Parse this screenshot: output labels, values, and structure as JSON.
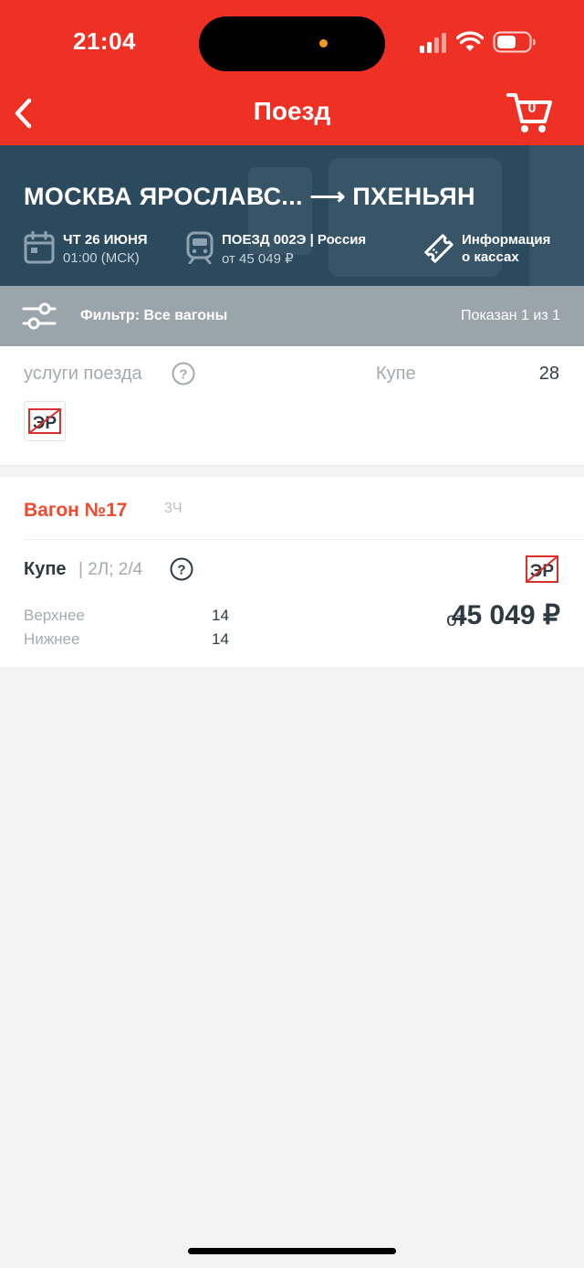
{
  "status_bar": {
    "time": "21:04"
  },
  "app_bar": {
    "title": "Поезд",
    "cart_count": "0",
    "back_icon": "chevron-left-icon",
    "cart_icon": "cart-icon"
  },
  "route": {
    "title": "МОСКВА ЯРОСЛАВС... ⟶ ПХЕНЬЯН",
    "date": "ЧТ 26 ИЮНЯ",
    "time": "01:00 (МСК)",
    "train": "ПОЕЗД 002Э | Россия",
    "price_from": "от 45 049 ₽",
    "info_line1": "Информация",
    "info_line2": "о кассах"
  },
  "filter": {
    "label": "Фильтр: Все вагоны",
    "shown": "Показан 1 из 1"
  },
  "services": {
    "label": "услуги поезда",
    "class_label": "Купе",
    "class_count": "28",
    "er_text": "ЭР"
  },
  "wagon": {
    "number": "Вагон №17",
    "code": "3Ч",
    "type": "Купе",
    "detail": "| 2Л; 2/4",
    "upper_label": "Верхнее",
    "upper_count": "14",
    "lower_label": "Нижнее",
    "lower_count": "14",
    "price_prefix": "от",
    "price": "45 049 ₽",
    "er_text": "ЭР"
  },
  "colors": {
    "brand_red": "#ee3124",
    "banner": "#2c4a5e",
    "filter_bar": "#9aa4ab",
    "wagon_accent": "#ee4a2e"
  }
}
